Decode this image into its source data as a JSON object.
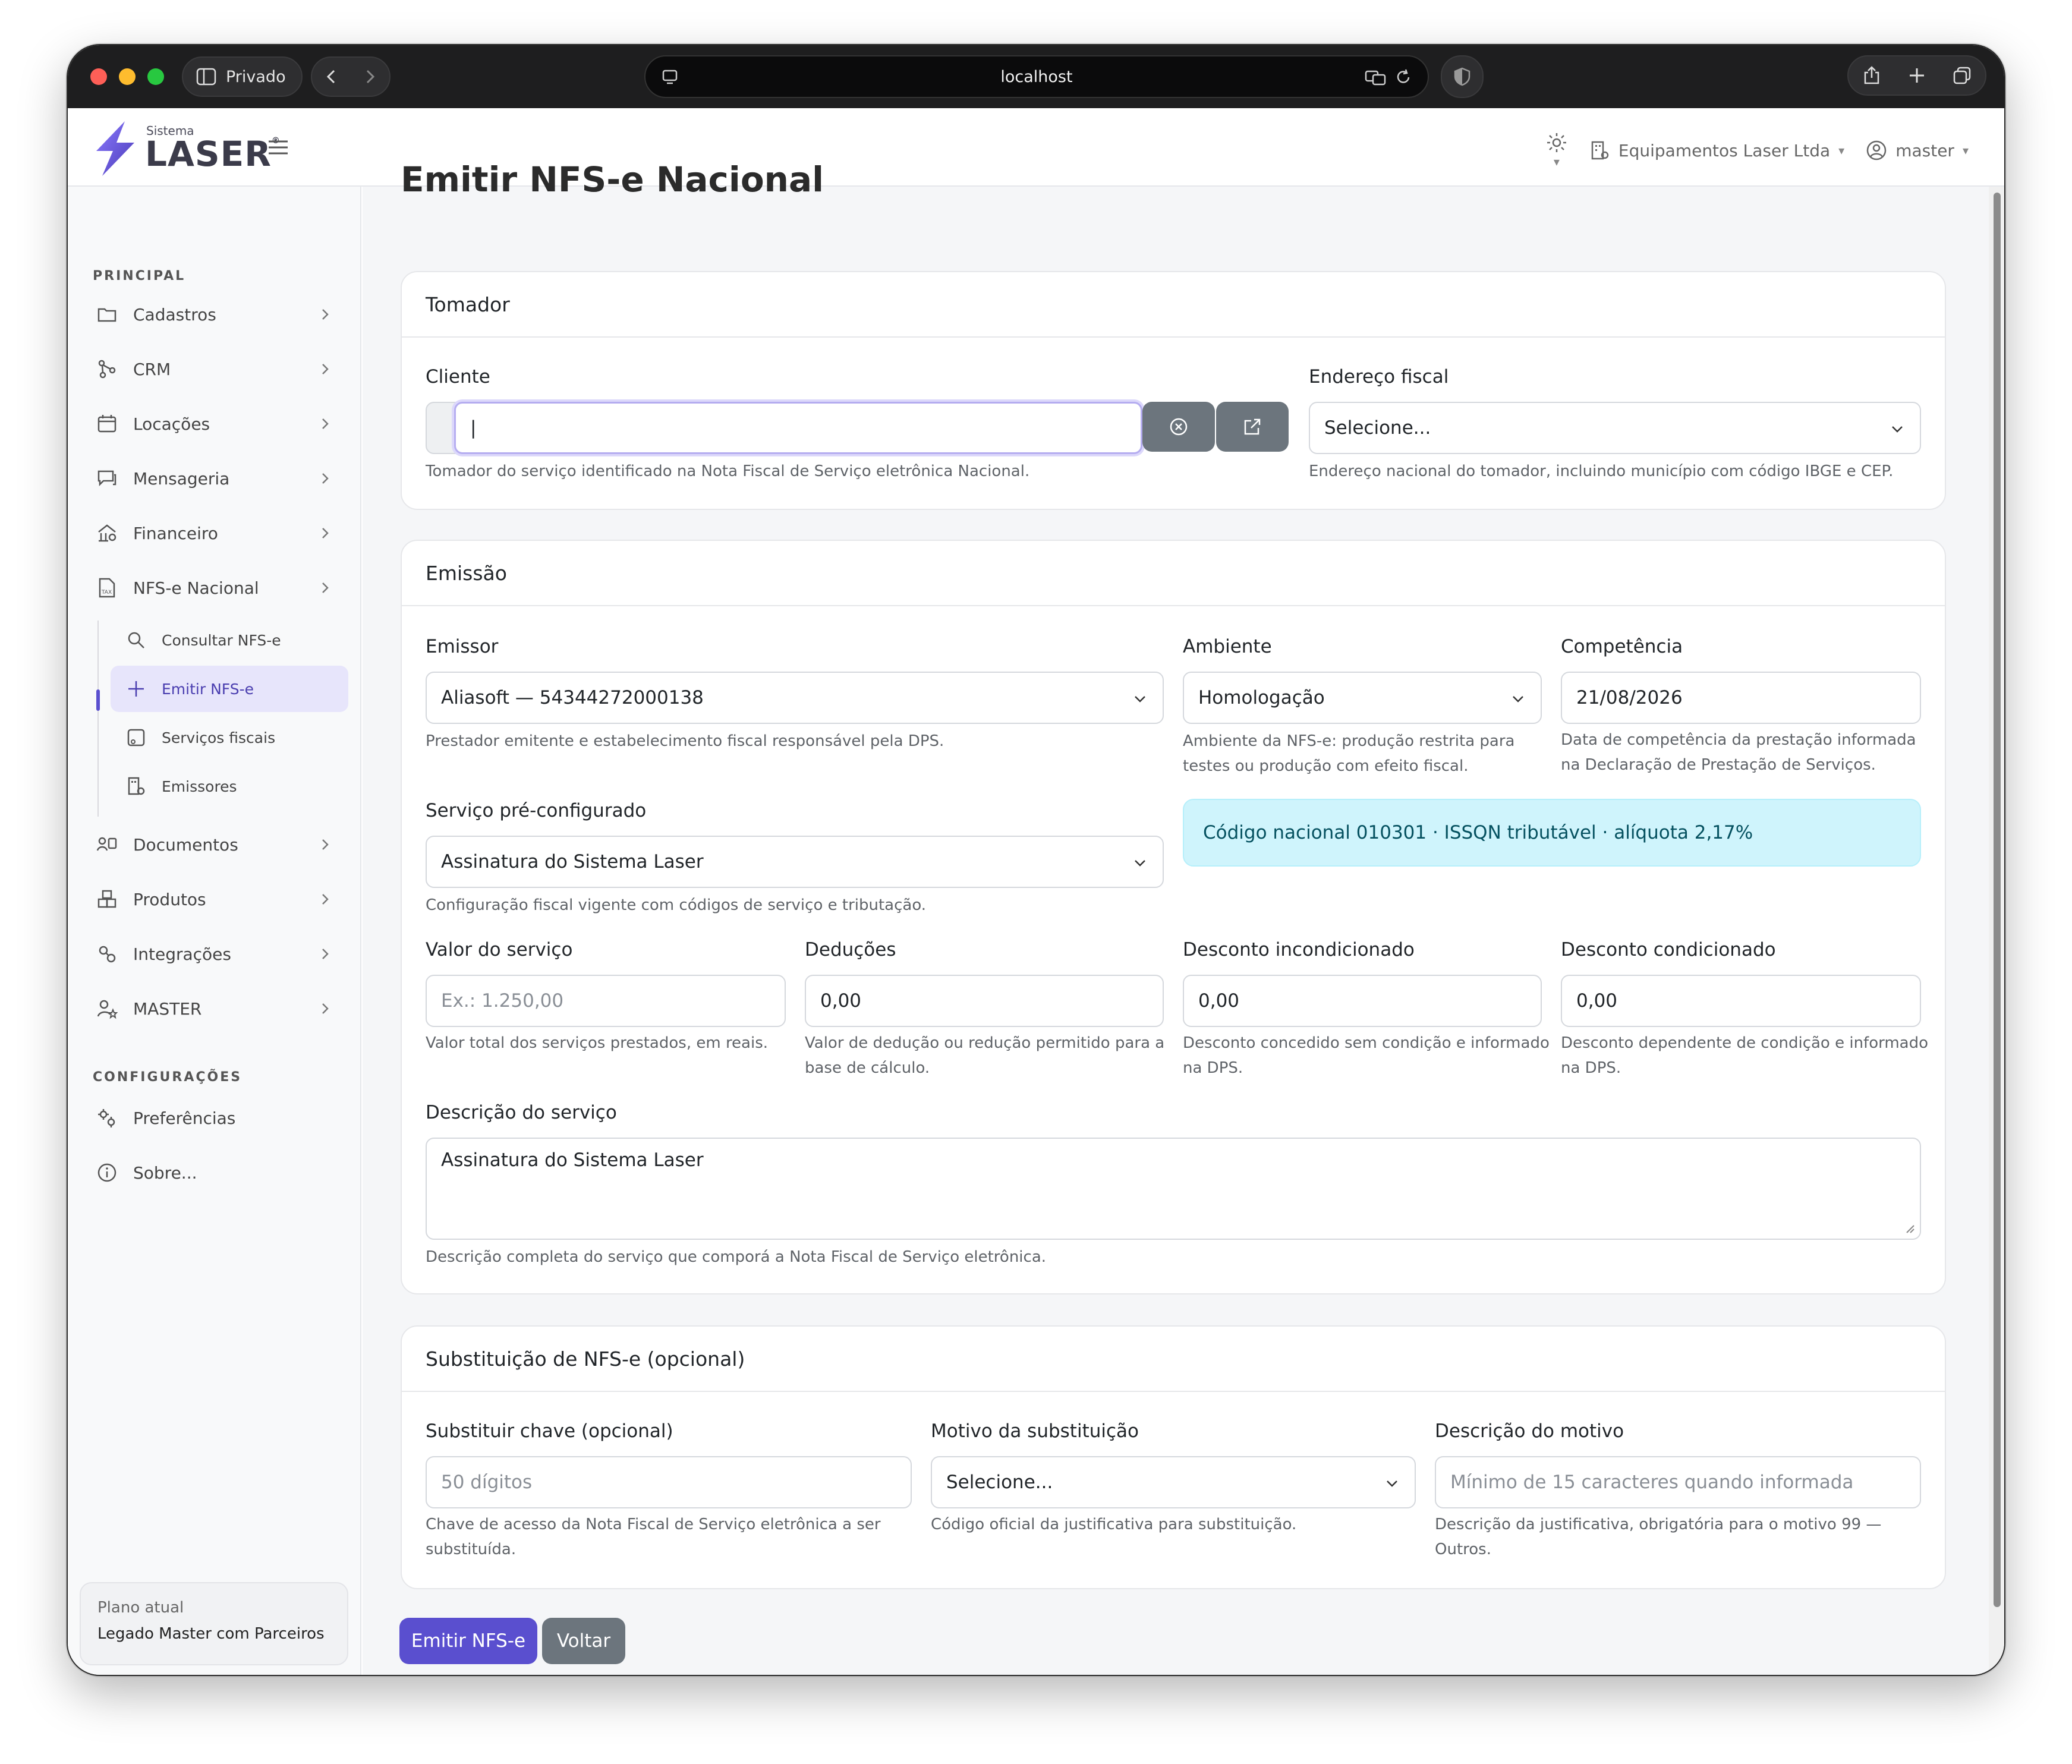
{
  "browser": {
    "private_label": "Privado",
    "url": "localhost"
  },
  "app": {
    "logo_small": "Sistema",
    "logo_big": "LASER",
    "company": "Equipamentos Laser Ltda",
    "user": "master"
  },
  "sidebar": {
    "section_principal": "PRINCIPAL",
    "items": [
      {
        "label": "Cadastros",
        "icon": "folder-icon"
      },
      {
        "label": "CRM",
        "icon": "network-icon"
      },
      {
        "label": "Locações",
        "icon": "calendar-icon"
      },
      {
        "label": "Mensageria",
        "icon": "chat-icon"
      },
      {
        "label": "Financeiro",
        "icon": "finance-icon"
      },
      {
        "label": "NFS-e Nacional",
        "icon": "tax-icon"
      }
    ],
    "subitems": [
      {
        "label": "Consultar NFS-e",
        "icon": "search-icon"
      },
      {
        "label": "Emitir NFS-e",
        "icon": "plus-icon"
      },
      {
        "label": "Serviços fiscais",
        "icon": "service-icon"
      },
      {
        "label": "Emissores",
        "icon": "building-icon"
      }
    ],
    "items2": [
      {
        "label": "Documentos",
        "icon": "documents-icon"
      },
      {
        "label": "Produtos",
        "icon": "products-icon"
      },
      {
        "label": "Integrações",
        "icon": "integrations-icon"
      },
      {
        "label": "MASTER",
        "icon": "user-star-icon"
      }
    ],
    "section_config": "CONFIGURAÇÕES",
    "config_items": [
      {
        "label": "Preferências",
        "icon": "gears-icon"
      },
      {
        "label": "Sobre...",
        "icon": "info-icon"
      }
    ],
    "plan_label": "Plano atual",
    "plan_value": "Legado Master com Parceiros"
  },
  "page": {
    "title": "Emitir NFS-e Nacional"
  },
  "tomador": {
    "header": "Tomador",
    "cliente_label": "Cliente",
    "cliente_value": "|",
    "cliente_hint": "Tomador do serviço identificado na Nota Fiscal de Serviço eletrônica Nacional.",
    "endereco_label": "Endereço fiscal",
    "endereco_value": "Selecione...",
    "endereco_hint": "Endereço nacional do tomador, incluindo município com código IBGE e CEP."
  },
  "emissao": {
    "header": "Emissão",
    "emissor_label": "Emissor",
    "emissor_value": "Aliasoft — 54344272000138",
    "emissor_hint": "Prestador emitente e estabelecimento fiscal responsável pela DPS.",
    "ambiente_label": "Ambiente",
    "ambiente_value": "Homologação",
    "ambiente_hint1": "Ambiente da NFS-e: produção restrita para",
    "ambiente_hint2": "testes ou produção com efeito fiscal.",
    "competencia_label": "Competência",
    "competencia_value": "21/08/2026",
    "competencia_hint1": "Data de competência da prestação informada",
    "competencia_hint2": "na Declaração de Prestação de Serviços.",
    "servico_label": "Serviço pré-configurado",
    "servico_value": "Assinatura do Sistema Laser",
    "servico_hint": "Configuração fiscal vigente com códigos de serviço e tributação.",
    "info_text": "Código nacional 010301 · ISSQN tributável · alíquota 2,17%",
    "valor_label": "Valor do serviço",
    "valor_placeholder": "Ex.: 1.250,00",
    "valor_hint": "Valor total dos serviços prestados, em reais.",
    "deducoes_label": "Deduções",
    "deducoes_value": "0,00",
    "deducoes_hint1": "Valor de dedução ou redução permitido para a",
    "deducoes_hint2": "base de cálculo.",
    "desc_incond_label": "Desconto incondicionado",
    "desc_incond_value": "0,00",
    "desc_incond_hint1": "Desconto concedido sem condição e informado",
    "desc_incond_hint2": "na DPS.",
    "desc_cond_label": "Desconto condicionado",
    "desc_cond_value": "0,00",
    "desc_cond_hint1": "Desconto dependente de condição e informado",
    "desc_cond_hint2": "na DPS.",
    "descricao_label": "Descrição do serviço",
    "descricao_value": "Assinatura do Sistema Laser",
    "descricao_hint": "Descrição completa do serviço que comporá a Nota Fiscal de Serviço eletrônica."
  },
  "substituicao": {
    "header": "Substituição de NFS-e (opcional)",
    "chave_label": "Substituir chave (opcional)",
    "chave_placeholder": "50 dígitos",
    "chave_hint1": "Chave de acesso da Nota Fiscal de Serviço eletrônica a ser",
    "chave_hint2": "substituída.",
    "motivo_label": "Motivo da substituição",
    "motivo_value": "Selecione...",
    "motivo_hint": "Código oficial da justificativa para substituição.",
    "descmotivo_label": "Descrição do motivo",
    "descmotivo_placeholder": "Mínimo de 15 caracteres quando informada",
    "descmotivo_hint1": "Descrição da justificativa, obrigatória para o motivo 99 —",
    "descmotivo_hint2": "Outros."
  },
  "actions": {
    "emitir": "Emitir NFS-e",
    "voltar": "Voltar"
  },
  "colors": {
    "primary": "#5a4fcf",
    "secondary": "#6c757d",
    "info_bg": "#cff4fc",
    "info_text": "#055160"
  }
}
